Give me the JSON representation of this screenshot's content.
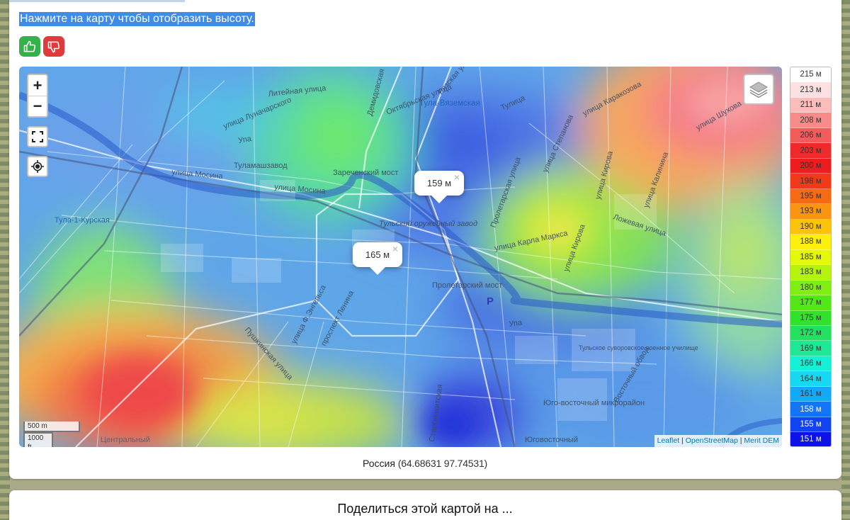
{
  "instruction": "Нажмите на карту чтобы отобразить высоту.",
  "vote": {
    "like_icon": "thumbs-up-icon",
    "dislike_icon": "thumbs-down-icon",
    "like_color": "#34b24a",
    "dislike_color": "#e03a3a"
  },
  "map": {
    "zoom_in": "+",
    "zoom_out": "−",
    "labels": [
      "Литейная улица",
      "улица Луначарского",
      "Демидовская",
      "Октябрьская улица",
      "Рязская улица",
      "Тула-Вяземская",
      "Тулица",
      "улица Каракозова",
      "улица Шухова",
      "Упа",
      "Туламашзавод",
      "Зареченский мост",
      "улица Мосина",
      "улица Мосина",
      "улица Степанова",
      "улица Кирова",
      "улица Калинина",
      "Тула-1-Курская",
      "Тульский оружейный завод",
      "Пролетарская улица",
      "Ложевая улица",
      "улица Карла Маркса",
      "улица Кирова",
      "Пролетарский мост",
      "P",
      "Упа",
      "Пушкинская улица",
      "улица Ф.Энгельса",
      "проспект Ленина",
      "Тульское суворовское военное училище",
      "Восточный обвод",
      "Юго-восточный микрорайон",
      "Юговосточный",
      "Центральный",
      "Староникитская"
    ],
    "markers": [
      {
        "value": "159 м"
      },
      {
        "value": "165 м"
      }
    ],
    "popup_close": "×",
    "scale_metric": "500 m",
    "scale_imperial": "1000 ft",
    "attribution": {
      "leaflet": "Leaflet",
      "sep": " | ",
      "osm": "OpenStreetMap",
      "dem": "Merit DEM"
    }
  },
  "legend": [
    {
      "label": "215 м",
      "color": "#ffffff",
      "text": "#333333"
    },
    {
      "label": "213 м",
      "color": "#fde0e0",
      "text": "#333333"
    },
    {
      "label": "211 м",
      "color": "#fbbcbc",
      "text": "#333333"
    },
    {
      "label": "208 м",
      "color": "#f88a8a",
      "text": "#333333"
    },
    {
      "label": "206 м",
      "color": "#f45c5c",
      "text": "#333333"
    },
    {
      "label": "203 м",
      "color": "#f02a2a",
      "text": "#333333"
    },
    {
      "label": "200 м",
      "color": "#ee1c1c",
      "text": "#333333"
    },
    {
      "label": "198 м",
      "color": "#f23a1a",
      "text": "#333333"
    },
    {
      "label": "195 м",
      "color": "#f76a14",
      "text": "#333333"
    },
    {
      "label": "193 м",
      "color": "#fb9410",
      "text": "#333333"
    },
    {
      "label": "190 м",
      "color": "#fdc20a",
      "text": "#333333"
    },
    {
      "label": "188 м",
      "color": "#fef00a",
      "text": "#333333"
    },
    {
      "label": "185 м",
      "color": "#e4f80a",
      "text": "#333333"
    },
    {
      "label": "183 м",
      "color": "#b4f40c",
      "text": "#333333"
    },
    {
      "label": "180 м",
      "color": "#80ee12",
      "text": "#333333"
    },
    {
      "label": "177 м",
      "color": "#52e818",
      "text": "#333333"
    },
    {
      "label": "175 м",
      "color": "#30e22c",
      "text": "#333333"
    },
    {
      "label": "172 м",
      "color": "#22e060",
      "text": "#333333"
    },
    {
      "label": "169 м",
      "color": "#1ee896",
      "text": "#333333"
    },
    {
      "label": "166 м",
      "color": "#14f0d6",
      "text": "#333333"
    },
    {
      "label": "164 м",
      "color": "#16d8f2",
      "text": "#333333"
    },
    {
      "label": "161 м",
      "color": "#14a8f8",
      "text": "#333333"
    },
    {
      "label": "158 м",
      "color": "#1274f8",
      "text": "#ffffff"
    },
    {
      "label": "155 м",
      "color": "#1044f2",
      "text": "#ffffff"
    },
    {
      "label": "151 м",
      "color": "#0c12e8",
      "text": "#ffffff"
    }
  ],
  "location": {
    "country": "Россия",
    "coords": "(64.68631 97.74531)"
  },
  "share": {
    "title": "Поделиться этой картой на ..."
  }
}
